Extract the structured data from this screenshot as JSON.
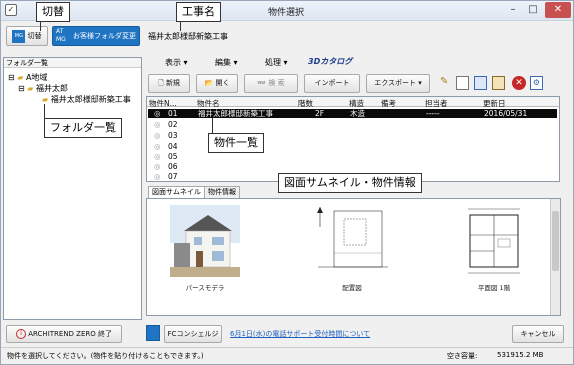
{
  "window": {
    "title": "物件選択",
    "min": "–",
    "max": "□",
    "close": "✕"
  },
  "toolbar1": {
    "switch_label": "切替",
    "switch_icon_text": "MG",
    "folder_change_icon_text": "AT\nMG",
    "folder_change_label": "お客様フォルダ変更",
    "project_name": "福井太郎様邸新築工事"
  },
  "callouts": {
    "switch": "切替",
    "project_name": "工事名",
    "folder_list": "フォルダ一覧",
    "property_list": "物件一覧",
    "thumbnail": "図面サムネイル・物件情報"
  },
  "menus": [
    "表示",
    "編集",
    "処理"
  ],
  "catalog_label": "3Dカタログ",
  "toolbar2": {
    "new": "新規",
    "open": "開く",
    "search": "検 索",
    "import": "インポート",
    "export": "エクスポート"
  },
  "folder_panel": {
    "header": "フォルダ一覧",
    "tree": [
      {
        "label": "A地域",
        "level": 0
      },
      {
        "label": "福井太郎",
        "level": 1
      },
      {
        "label": "福井太郎様邸新築工事",
        "level": 2
      }
    ]
  },
  "table": {
    "columns": [
      "物件N...",
      "物件名",
      "階数",
      "構造",
      "備考",
      "担当者",
      "更新日"
    ],
    "rows": [
      {
        "no": "01",
        "name": "福井太郎様邸新築工事",
        "floors": "2F",
        "structure": "木造",
        "note": "",
        "staff": "-----",
        "date": "2016/05/31",
        "selected": true
      },
      {
        "no": "02",
        "name": "",
        "floors": "",
        "structure": "",
        "note": "",
        "staff": "",
        "date": ""
      },
      {
        "no": "03",
        "name": "",
        "floors": "",
        "structure": "",
        "note": "",
        "staff": "",
        "date": ""
      },
      {
        "no": "04",
        "name": "",
        "floors": "",
        "structure": "",
        "note": "",
        "staff": "",
        "date": ""
      },
      {
        "no": "05",
        "name": "",
        "floors": "",
        "structure": "",
        "note": "",
        "staff": "",
        "date": ""
      },
      {
        "no": "06",
        "name": "",
        "floors": "",
        "structure": "",
        "note": "",
        "staff": "",
        "date": ""
      },
      {
        "no": "07",
        "name": "",
        "floors": "",
        "structure": "",
        "note": "",
        "staff": "",
        "date": ""
      }
    ]
  },
  "tabs": [
    "図面サムネイル",
    "物件情報"
  ],
  "thumbnails": [
    "パースモデラ",
    "配置図",
    "平面図 1階"
  ],
  "bottom": {
    "exit_label": "ARCHITREND ZERO 終了",
    "concierge_label": "FCコンシェルジュ",
    "notice_link": "6月1日(水)の電話サポート受付時間について",
    "cancel_label": "キャンセル"
  },
  "status": {
    "message": "物件を選択してください。(物件を貼り付けることもできます。)",
    "free_label": "空き容量:",
    "free_value": "531915.2 MB"
  },
  "colors": {
    "accent": "#1f74c3",
    "selected_row": "#0a0a0a",
    "exit_icon": "#c62828"
  }
}
